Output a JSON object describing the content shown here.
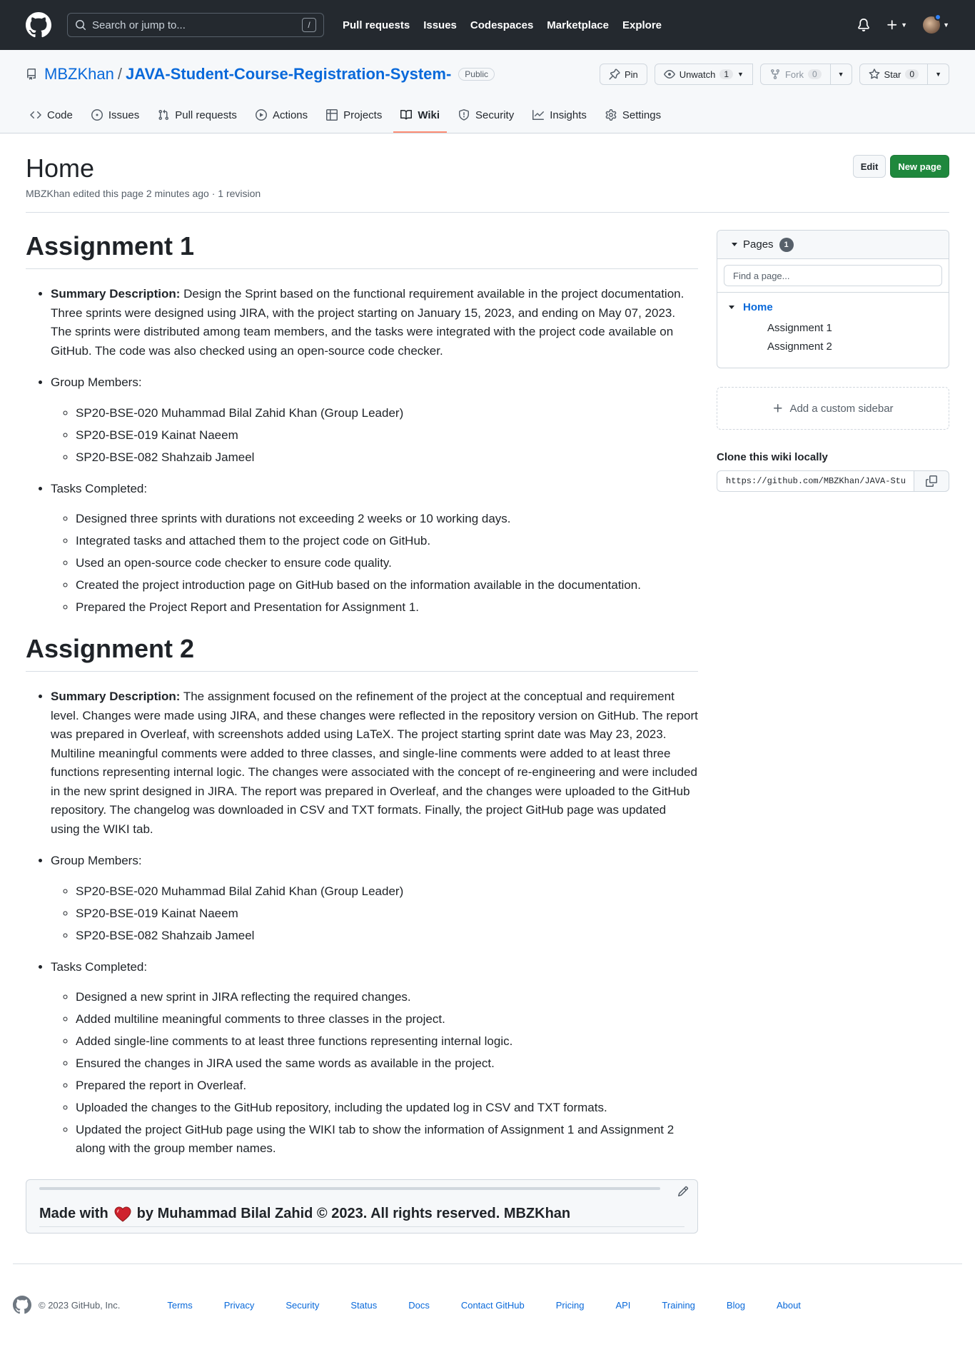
{
  "header": {
    "search_placeholder": "Search or jump to...",
    "search_shortcut": "/",
    "nav": [
      "Pull requests",
      "Issues",
      "Codespaces",
      "Marketplace",
      "Explore"
    ]
  },
  "repo": {
    "owner": "MBZKhan",
    "separator": "/",
    "name": "JAVA-Student-Course-Registration-System-",
    "visibility": "Public",
    "actions": {
      "pin": "Pin",
      "unwatch": "Unwatch",
      "watch_count": "1",
      "fork": "Fork",
      "fork_count": "0",
      "star": "Star",
      "star_count": "0"
    },
    "tabs": [
      "Code",
      "Issues",
      "Pull requests",
      "Actions",
      "Projects",
      "Wiki",
      "Security",
      "Insights",
      "Settings"
    ],
    "active_tab": "Wiki"
  },
  "wiki": {
    "title": "Home",
    "meta": "MBZKhan edited this page 2 minutes ago · 1 revision",
    "edit_label": "Edit",
    "new_page_label": "New page",
    "assignments": [
      {
        "heading": "Assignment 1",
        "summary_label": "Summary Description:",
        "summary": "Design the Sprint based on the functional requirement available in the project documentation. Three sprints were designed using JIRA, with the project starting on January 15, 2023, and ending on May 07, 2023. The sprints were distributed among team members, and the tasks were integrated with the project code available on GitHub. The code was also checked using an open-source code checker.",
        "members_label": "Group Members:",
        "members": [
          "SP20-BSE-020 Muhammad Bilal Zahid Khan (Group Leader)",
          "SP20-BSE-019 Kainat Naeem",
          "SP20-BSE-082 Shahzaib Jameel"
        ],
        "tasks_label": "Tasks Completed:",
        "tasks": [
          "Designed three sprints with durations not exceeding 2 weeks or 10 working days.",
          "Integrated tasks and attached them to the project code on GitHub.",
          "Used an open-source code checker to ensure code quality.",
          "Created the project introduction page on GitHub based on the information available in the documentation.",
          "Prepared the Project Report and Presentation for Assignment 1."
        ]
      },
      {
        "heading": "Assignment 2",
        "summary_label": "Summary Description:",
        "summary": "The assignment focused on the refinement of the project at the conceptual and requirement level. Changes were made using JIRA, and these changes were reflected in the repository version on GitHub. The report was prepared in Overleaf, with screenshots added using LaTeX. The project starting sprint date was May 23, 2023. Multiline meaningful comments were added to three classes, and single-line comments were added to at least three functions representing internal logic. The changes were associated with the concept of re-engineering and were included in the new sprint designed in JIRA. The report was prepared in Overleaf, and the changes were uploaded to the GitHub repository. The changelog was downloaded in CSV and TXT formats. Finally, the project GitHub page was updated using the WIKI tab.",
        "members_label": "Group Members:",
        "members": [
          "SP20-BSE-020 Muhammad Bilal Zahid Khan (Group Leader)",
          "SP20-BSE-019 Kainat Naeem",
          "SP20-BSE-082 Shahzaib Jameel"
        ],
        "tasks_label": "Tasks Completed:",
        "tasks": [
          "Designed a new sprint in JIRA reflecting the required changes.",
          "Added multiline meaningful comments to three classes in the project.",
          "Added single-line comments to at least three functions representing internal logic.",
          "Ensured the changes in JIRA used the same words as available in the project.",
          "Prepared the report in Overleaf.",
          "Uploaded the changes to the GitHub repository, including the updated log in CSV and TXT formats.",
          "Updated the project GitHub page using the WIKI tab to show the information of Assignment 1 and Assignment 2 along with the group member names."
        ]
      }
    ],
    "footer": {
      "made_with": "Made with",
      "by_text": "by Muhammad Bilal Zahid © 2023. All rights reserved. MBZKhan"
    }
  },
  "sidebar": {
    "pages_label": "Pages",
    "pages_count": "1",
    "find_placeholder": "Find a page...",
    "home": "Home",
    "subpages": [
      "Assignment 1",
      "Assignment 2"
    ],
    "add_sidebar": "Add a custom sidebar",
    "clone_label": "Clone this wiki locally",
    "clone_url": "https://github.com/MBZKhan/JAVA-Student-Course-Registration-System-.wiki.git"
  },
  "site_footer": {
    "copyright": "© 2023 GitHub, Inc.",
    "links": [
      "Terms",
      "Privacy",
      "Security",
      "Status",
      "Docs",
      "Contact GitHub",
      "Pricing",
      "API",
      "Training",
      "Blog",
      "About"
    ]
  },
  "colors": {
    "header_bg": "#24292f",
    "link": "#0969da",
    "primary_button": "#1f883d",
    "active_tab_underline": "#fd8c73",
    "heart": "#cf222e"
  }
}
